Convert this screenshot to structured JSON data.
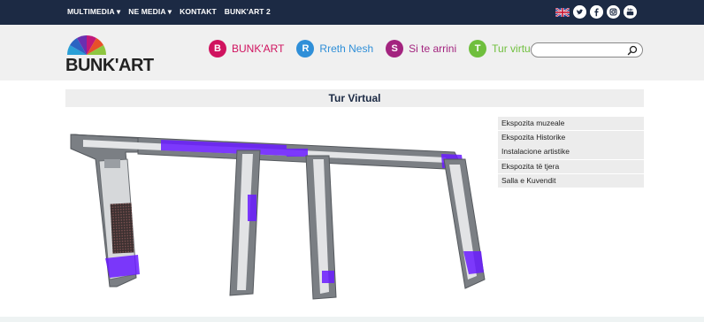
{
  "topnav": {
    "items": [
      "MULTIMEDIA ▾",
      "NE MEDIA ▾",
      "KONTAKT",
      "BUNK'ART 2"
    ]
  },
  "social": {
    "icons": [
      "uk-flag-icon",
      "twitter-icon",
      "facebook-icon",
      "instagram-icon",
      "youtube-icon"
    ]
  },
  "logo": {
    "text": "BUNK'ART"
  },
  "mainnav": {
    "items": [
      {
        "letter": "B",
        "label": "BUNK'ART",
        "color": "#d0135f"
      },
      {
        "letter": "R",
        "label": "Rreth Nesh",
        "color": "#2f8fd8"
      },
      {
        "letter": "S",
        "label": "Si te arrini",
        "color": "#a3247f"
      },
      {
        "letter": "T",
        "label": "Tur virtual",
        "color": "#6fbf3d"
      }
    ]
  },
  "search": {
    "placeholder": ""
  },
  "page": {
    "title": "Tur Virtual"
  },
  "sidemenu": {
    "items": [
      "Ekspozita muzeale",
      "Ekspozita Historike",
      "Instalacione artistike",
      "Ekspozita të tjera",
      "Salla e Kuvendit"
    ]
  },
  "colors": {
    "topbar": "#1c2a44",
    "highlight": "#6a1bff",
    "wall": "#7b7f84"
  }
}
